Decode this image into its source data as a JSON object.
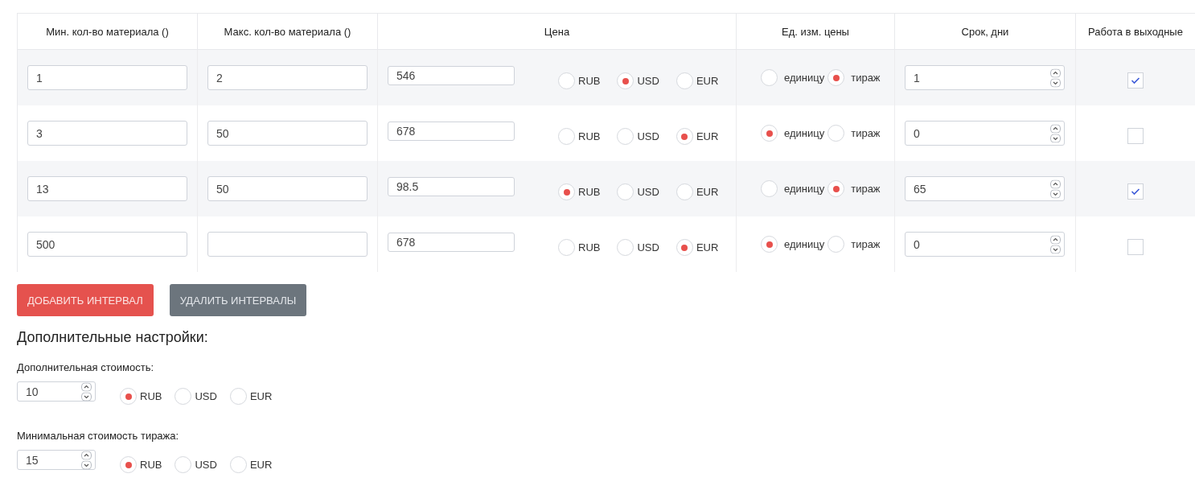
{
  "table": {
    "columns": [
      "Мин. кол-во материала ()",
      "Макс. кол-во материала ()",
      "Цена",
      "Ед. изм. цены",
      "Срок, дни",
      "Работа в выходные"
    ],
    "rows": [
      {
        "min": "1",
        "max": "2",
        "price": "546",
        "currencies": [
          {
            "label": "RUB",
            "selected": false
          },
          {
            "label": "USD",
            "selected": true
          },
          {
            "label": "EUR",
            "selected": false
          }
        ],
        "units": [
          {
            "label": "единицу",
            "selected": false
          },
          {
            "label": "тираж",
            "selected": true
          }
        ],
        "days": "1",
        "weekend": true
      },
      {
        "min": "3",
        "max": "50",
        "price": "678",
        "currencies": [
          {
            "label": "RUB",
            "selected": false
          },
          {
            "label": "USD",
            "selected": false
          },
          {
            "label": "EUR",
            "selected": true
          }
        ],
        "units": [
          {
            "label": "единицу",
            "selected": true
          },
          {
            "label": "тираж",
            "selected": false
          }
        ],
        "days": "0",
        "weekend": false
      },
      {
        "min": "13",
        "max": "50",
        "price": "98.5",
        "currencies": [
          {
            "label": "RUB",
            "selected": true
          },
          {
            "label": "USD",
            "selected": false
          },
          {
            "label": "EUR",
            "selected": false
          }
        ],
        "units": [
          {
            "label": "единицу",
            "selected": false
          },
          {
            "label": "тираж",
            "selected": true
          }
        ],
        "days": "65",
        "weekend": true
      },
      {
        "min": "500",
        "price": "678",
        "currencies": [
          {
            "label": "RUB",
            "selected": false
          },
          {
            "label": "USD",
            "selected": false
          },
          {
            "label": "EUR",
            "selected": true
          }
        ],
        "units": [
          {
            "label": "единицу",
            "selected": true
          },
          {
            "label": "тираж",
            "selected": false
          }
        ],
        "days": "0",
        "weekend": false
      }
    ]
  },
  "buttons": [
    {
      "label": "ДОБАВИТЬ ИНТЕРВАЛ",
      "kind": "primary"
    },
    {
      "label": "УДАЛИТЬ ИНТЕРВАЛЫ",
      "kind": "secondary"
    }
  ],
  "extra": {
    "title": "Дополнительные настройки:",
    "settings": [
      {
        "label": "Дополнительная стоимость:",
        "value": "10",
        "currencies": [
          {
            "label": "RUB",
            "selected": true
          },
          {
            "label": "USD",
            "selected": false
          },
          {
            "label": "EUR",
            "selected": false
          }
        ]
      },
      {
        "label": "Минимальная стоимость тиража:",
        "value": "15",
        "currencies": [
          {
            "label": "RUB",
            "selected": true
          },
          {
            "label": "USD",
            "selected": false
          },
          {
            "label": "EUR",
            "selected": false
          }
        ]
      }
    ]
  }
}
